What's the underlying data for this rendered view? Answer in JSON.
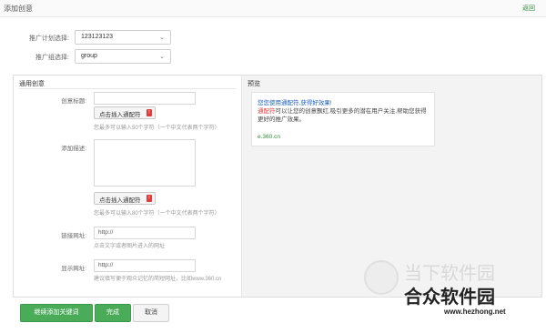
{
  "header": {
    "title": "添加创意",
    "back_label": "返回"
  },
  "form": {
    "plan_label": "推广计划选择:",
    "plan_value": "123123123",
    "group_label": "推广组选择:",
    "group_value": "group"
  },
  "left_panel": {
    "heading": "通用创意",
    "title_label": "创意标题:",
    "title_btn": "点击插入通配符",
    "title_hint": "您最多可以输入50个字符（一个中文代表两个字符）",
    "desc_label": "添加描述:",
    "desc_btn": "点击插入通配符",
    "desc_hint": "您最多可以输入80个字符（一个中文代表两个字符）",
    "link_label": "链接网址:",
    "link_value": "http://",
    "link_hint": "点击文字或者图片进入的网址",
    "display_label": "显示网址:",
    "display_value": "http://",
    "display_hint": "建议填写便于观众记忆的简短网址，比如www.360.cn"
  },
  "preview": {
    "heading": "预览",
    "title": "您您使用通配符,获得好效果!",
    "desc_prefix": "通配符",
    "desc_rest": "可以让您的创意飘红,吸引更多的潜在用户关注,帮助您获得更好的推广效果。",
    "url": "e.360.cn"
  },
  "buttons": {
    "continue": "继续添加关键词",
    "done": "完成",
    "cancel": "取消"
  },
  "watermark": {
    "line1": "当下软件园",
    "line2": "合众软件园",
    "line3": "www.hezhong.net"
  }
}
